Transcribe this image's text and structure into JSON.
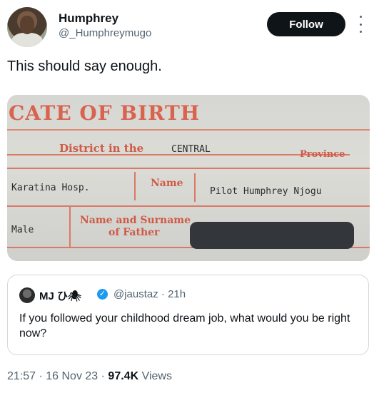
{
  "author": {
    "name": "Humphrey",
    "handle": "@_Humphreymugo"
  },
  "follow_label": "Follow",
  "tweet": {
    "text": "This should say enough."
  },
  "photo": {
    "title": "CATE OF BIRTH",
    "district_label": "District in the",
    "district_value": "CENTRAL",
    "province_label": "Province",
    "place_value": "Karatina Hosp.",
    "name_label": "Name",
    "name_value": "Pilot Humphrey Njogu",
    "sex_value": "Male",
    "father_label_line1": "Name and Surname",
    "father_label_line2": "of Father"
  },
  "quote": {
    "name": "MJ ひ🕷",
    "handle": "@jaustaz · 21h",
    "text": "If you followed your childhood dream job, what would you be right now?"
  },
  "meta": {
    "timestamp": "21:57 · 16 Nov 23 · ",
    "views_count": "97.4K",
    "views_label": " Views"
  }
}
